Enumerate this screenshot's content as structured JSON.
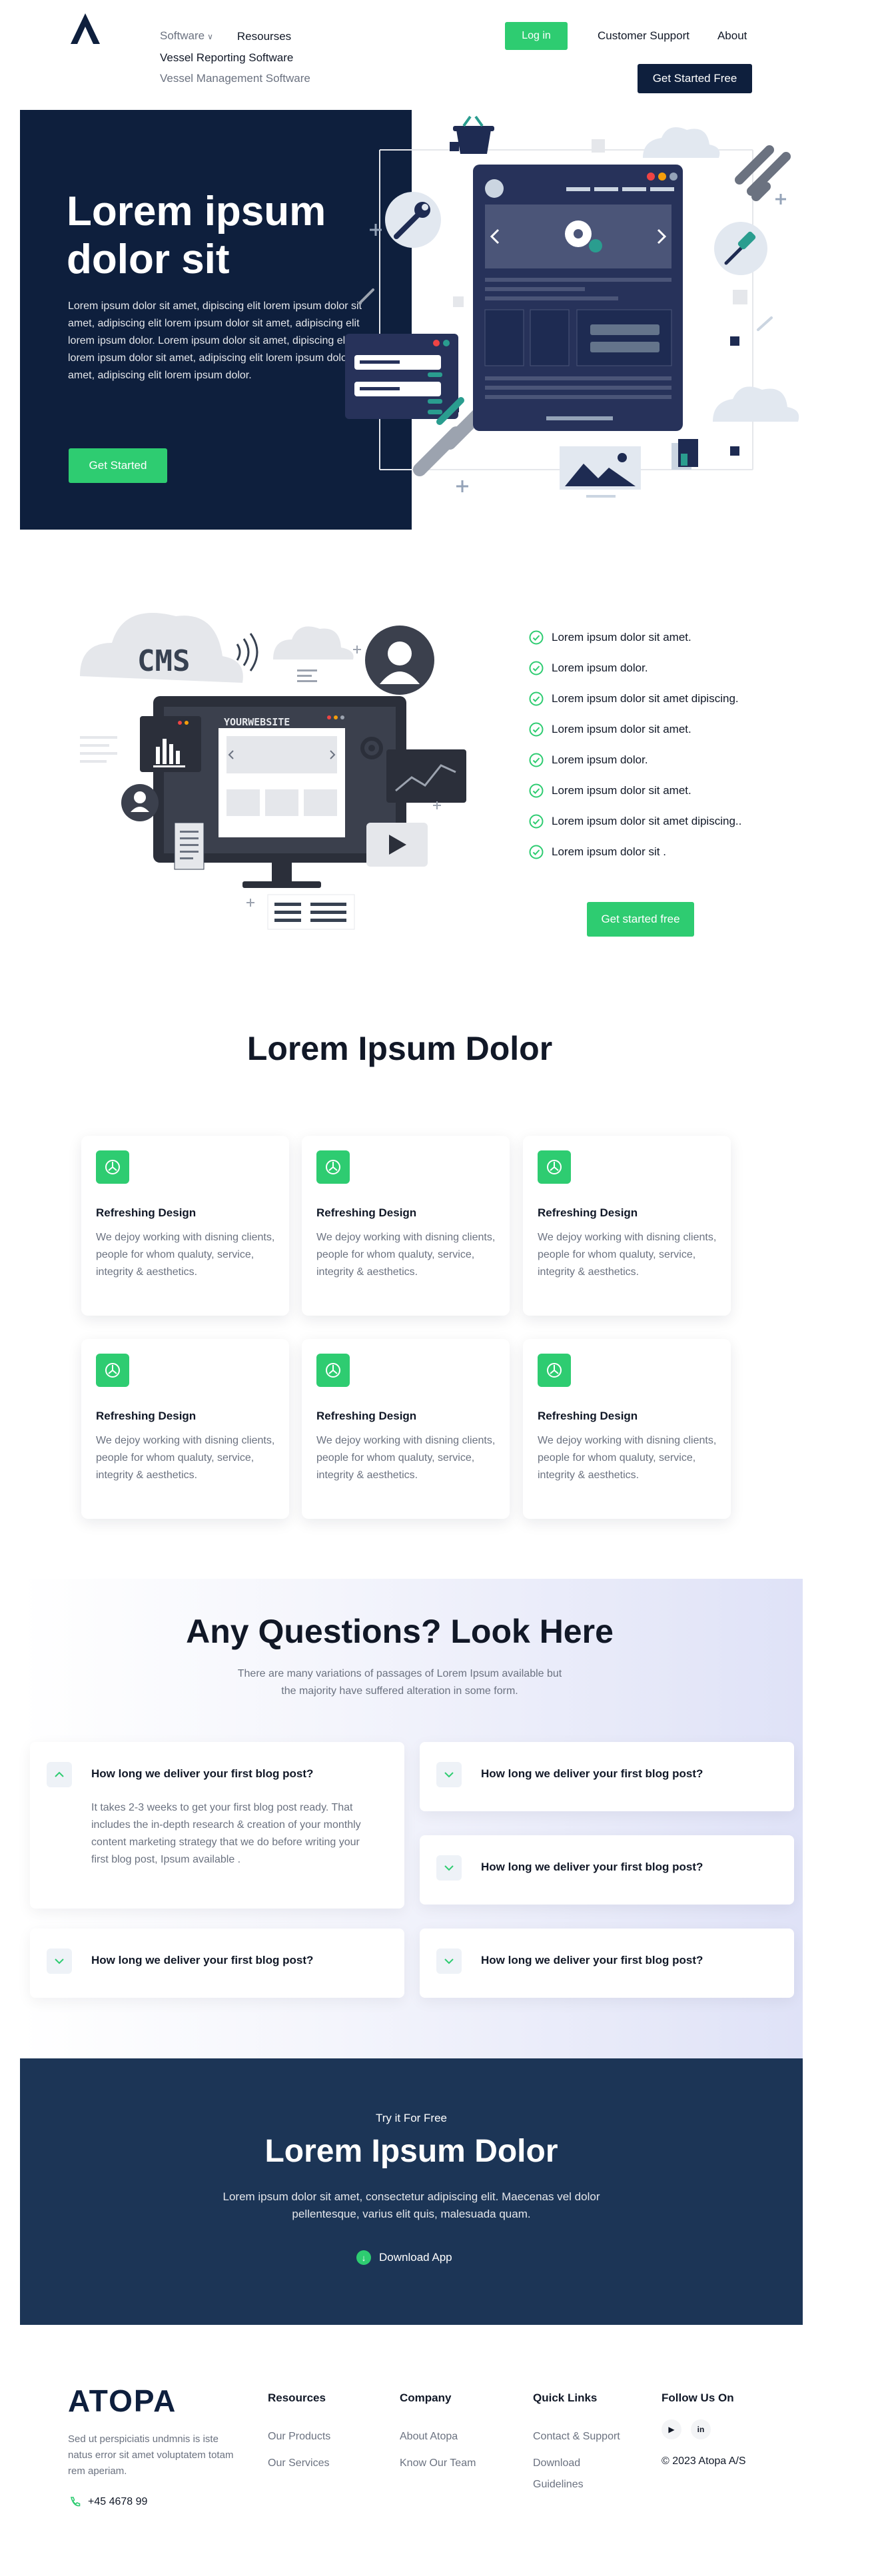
{
  "header": {
    "nav": {
      "software": "Software",
      "resources": "Resourses",
      "submenu": [
        "Vessel Reporting Software",
        "Vessel Management Software"
      ]
    },
    "login": "Log in",
    "customer_support": "Customer Support",
    "about": "About",
    "get_started_free": "Get Started Free"
  },
  "hero": {
    "title": "Lorem ipsum dolor sit",
    "text": "Lorem ipsum dolor sit amet, dipiscing elit lorem ipsum dolor sit amet, adipiscing elit lorem ipsum dolor sit amet, adipiscing elit lorem ipsum dolor. Lorem ipsum dolor sit amet, dipiscing elit lorem ipsum dolor sit amet, adipiscing elit lorem ipsum dolor sit amet, adipiscing elit lorem ipsum dolor.",
    "button": "Get Started"
  },
  "cms_illus": {
    "cms_label": "CMS",
    "website_label": "YOURWEBSITE"
  },
  "checklist": {
    "items": [
      "Lorem ipsum dolor sit amet.",
      "Lorem ipsum dolor.",
      "Lorem ipsum dolor sit amet dipiscing.",
      "Lorem ipsum dolor sit amet.",
      "Lorem ipsum dolor.",
      "Lorem ipsum dolor sit amet.",
      "Lorem ipsum dolor sit amet dipiscing..",
      "Lorem ipsum dolor sit ."
    ],
    "button": "Get started free"
  },
  "features": {
    "title": "Lorem Ipsum Dolor",
    "cards": [
      {
        "title": "Refreshing Design",
        "text": "We dejoy working with disning clients, people for whom qualuty, service, integrity & aesthetics."
      },
      {
        "title": "Refreshing Design",
        "text": "We dejoy working with disning clients, people for whom qualuty, service, integrity & aesthetics."
      },
      {
        "title": "Refreshing Design",
        "text": "We dejoy working with disning clients, people for whom qualuty, service, integrity & aesthetics."
      },
      {
        "title": "Refreshing Design",
        "text": "We dejoy working with disning clients, people for whom qualuty, service, integrity & aesthetics."
      },
      {
        "title": "Refreshing Design",
        "text": "We dejoy working with disning clients, people for whom qualuty, service, integrity & aesthetics."
      },
      {
        "title": "Refreshing Design",
        "text": "We dejoy working with disning clients, people for whom qualuty, service, integrity & aesthetics."
      }
    ]
  },
  "faq": {
    "title": "Any Questions? Look Here",
    "subtitle": "There are many variations of passages of Lorem Ipsum available but the majority have suffered alteration in some form.",
    "items": [
      {
        "question": "How long we deliver your first blog post?",
        "answer": "It takes 2-3 weeks to get your first blog post ready. That includes the in-depth research & creation of your monthly content marketing strategy that we do before writing your first blog post,  Ipsum available .",
        "expanded": true
      },
      {
        "question": "How long we deliver your first blog post?",
        "expanded": false
      },
      {
        "question": "How long we deliver your first blog post?",
        "expanded": false
      },
      {
        "question": "How long we deliver your first blog post?",
        "expanded": false
      },
      {
        "question": "How long we deliver your first blog post?",
        "expanded": false
      }
    ]
  },
  "cta": {
    "pre": "Try it For Free",
    "title": "Lorem Ipsum Dolor",
    "text": "Lorem ipsum dolor sit amet, consectetur adipiscing elit. Maecenas vel dolor pellentesque, varius elit quis, malesuada quam.",
    "button": "Download App"
  },
  "footer": {
    "brand": "ATOPA",
    "description": "Sed ut perspiciatis undmnis is iste natus error sit amet voluptatem totam rem aperiam.",
    "phone": "+45 4678 99",
    "resources": {
      "heading": "Resources",
      "links": [
        "Our Products",
        "Our Services"
      ]
    },
    "company": {
      "heading": "Company",
      "links": [
        "About Atopa",
        "Know Our Team"
      ]
    },
    "quick_links": {
      "heading": "Quick Links",
      "links": [
        "Contact & Support",
        "Download",
        "Guidelines"
      ]
    },
    "follow": {
      "heading": "Follow Us On",
      "youtube": "▶",
      "linkedin": "in"
    },
    "copyright": "© 2023 Atopa A/S"
  },
  "colors": {
    "navy": "#0e1f3d",
    "cta_navy": "#1c3556",
    "green": "#2ecc71",
    "gray_text": "#6b7280"
  }
}
